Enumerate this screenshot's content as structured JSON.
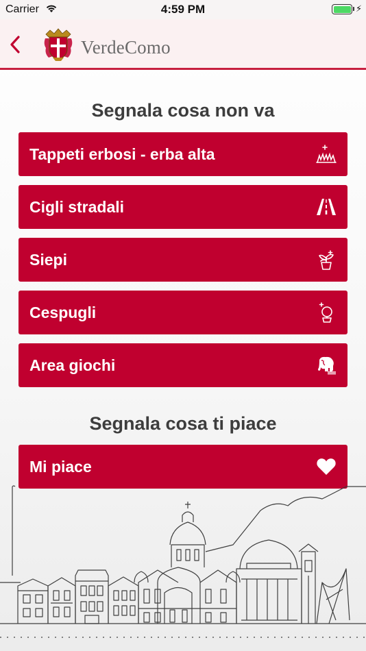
{
  "status_bar": {
    "carrier": "Carrier",
    "time": "4:59 PM",
    "battery_level": 1.0
  },
  "header": {
    "brand": "VerdeComo",
    "back_icon": "chevron-left-icon",
    "logo_icon": "como-crest-icon",
    "accent_color": "#c0002f"
  },
  "sections": {
    "report_problems": {
      "title": "Segnala cosa non va",
      "items": [
        {
          "label": "Tappeti erbosi - erba alta",
          "icon": "grass-icon"
        },
        {
          "label": "Cigli stradali",
          "icon": "road-icon"
        },
        {
          "label": "Siepi",
          "icon": "potted-plant-icon"
        },
        {
          "label": "Cespugli",
          "icon": "bush-icon"
        },
        {
          "label": "Area giochi",
          "icon": "playground-elephant-icon"
        }
      ]
    },
    "report_likes": {
      "title": "Segnala cosa ti piace",
      "items": [
        {
          "label": "Mi piace",
          "icon": "heart-icon"
        }
      ]
    }
  },
  "footer": {
    "illustration": "como-skyline-illustration"
  }
}
